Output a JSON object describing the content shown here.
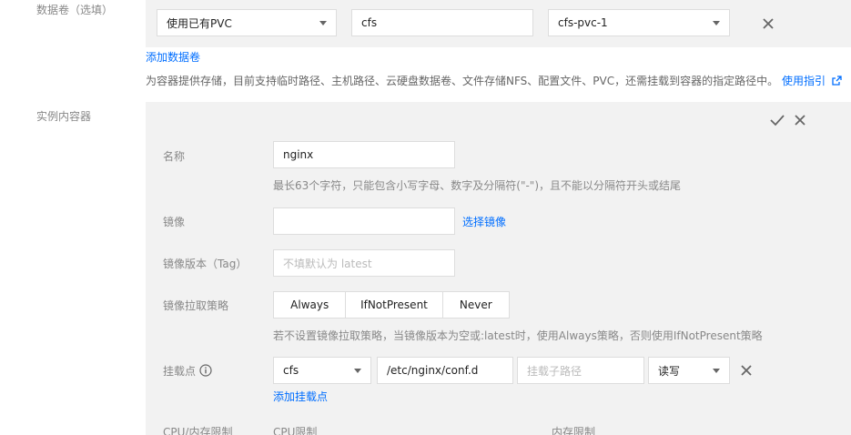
{
  "volumes": {
    "label": "数据卷（选填）",
    "type_select": "使用已有PVC",
    "name_value": "cfs",
    "pvc_select": "cfs-pvc-1",
    "add_link": "添加数据卷",
    "description": "为容器提供存储，目前支持临时路径、主机路径、云硬盘数据卷、文件存储NFS、配置文件、PVC，还需挂载到容器的指定路径中。",
    "guide_link": "使用指引"
  },
  "containers": {
    "label": "实例内容器",
    "name_label": "名称",
    "name_value": "nginx",
    "name_help": "最长63个字符，只能包含小写字母、数字及分隔符(\"-\")，且不能以分隔符开头或结尾",
    "image_label": "镜像",
    "image_value": "",
    "select_image_link": "选择镜像",
    "tag_label": "镜像版本（Tag）",
    "tag_placeholder": "不填默认为 latest",
    "pull_policy_label": "镜像拉取策略",
    "pull_policy_options": [
      "Always",
      "IfNotPresent",
      "Never"
    ],
    "pull_policy_help": "若不设置镜像拉取策略，当镜像版本为空或:latest时，使用Always策略，否则使用IfNotPresent策略",
    "mount_label": "挂载点",
    "mount_volume": "cfs",
    "mount_path": "/etc/nginx/conf.d",
    "mount_subpath_placeholder": "挂载子路径",
    "mount_mode": "读写",
    "add_mount_link": "添加挂载点",
    "cpu_mem_label": "CPU/内存限制",
    "cpu_limit_label": "CPU限制",
    "mem_limit_label": "内存限制"
  },
  "colors": {
    "accent": "#006eff",
    "panel": "#f2f2f2",
    "border": "#dddddd"
  }
}
